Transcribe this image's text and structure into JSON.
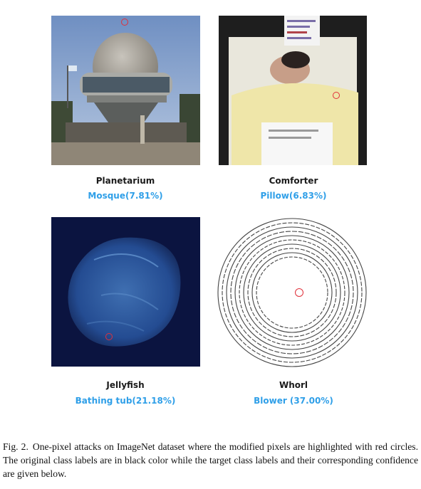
{
  "panels": [
    {
      "original": "Planetarium",
      "target": "Mosque(7.81%)",
      "image": "planetarium-photo"
    },
    {
      "original": "Comforter",
      "target": "Pillow(6.83%)",
      "image": "comforter-photo"
    },
    {
      "original": "Jellyfish",
      "target": "Bathing tub(21.18%)",
      "image": "jellyfish-photo"
    },
    {
      "original": "Whorl",
      "target": "Blower (37.00%)",
      "image": "whorl-image"
    }
  ],
  "caption": {
    "tag": "Fig. 2.",
    "text": "One-pixel attacks on ImageNet dataset where the modified pixels are highlighted with red circles. The original class labels are in black color while the target class labels and their corresponding confidence are given below."
  },
  "colors": {
    "target_label": "#2f9fe8",
    "highlight_circle": "#e0303a"
  }
}
